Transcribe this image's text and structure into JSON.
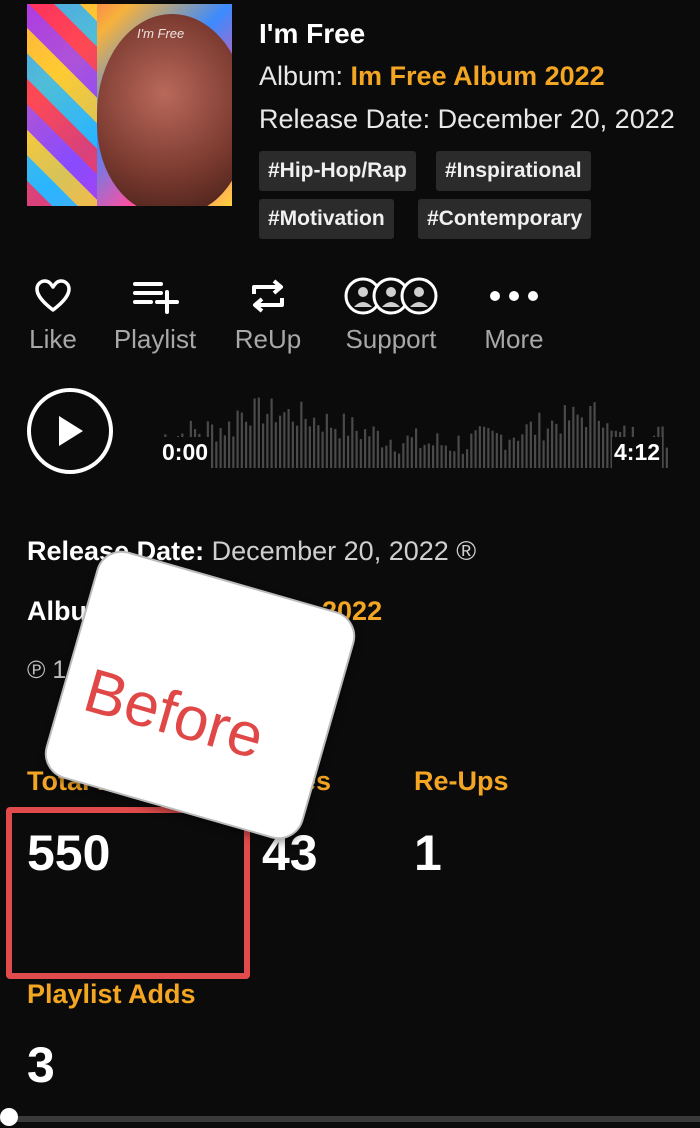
{
  "track": {
    "title": "I'm Free",
    "album_prefix": "Album: ",
    "album_name": "Im Free Album 2022",
    "release_line": "Release Date: December 20, 2022",
    "cover_script": "I'm Free",
    "tags": [
      "#Hip-Hop/Rap",
      "#Inspirational",
      "#Motivation",
      "#Contemporary"
    ]
  },
  "actions": [
    {
      "label": "Like",
      "icon": "heart-icon"
    },
    {
      "label": "Playlist",
      "icon": "playlist-add-icon"
    },
    {
      "label": "ReUp",
      "icon": "repost-icon"
    },
    {
      "label": "Support",
      "icon": "support-avatars-icon"
    },
    {
      "label": "More",
      "icon": "more-dots-icon"
    }
  ],
  "player": {
    "time_start": "0:00",
    "time_end": "4:12"
  },
  "meta": {
    "release_label": "Release Date:",
    "release_value": " December 20, 2022 ®",
    "album_label": "Album:",
    "album_value": "Im Free Album 2022",
    "copyright": "℗ 1 ... DK"
  },
  "stats": {
    "total_plays_label": "Total Plays",
    "total_plays": "550",
    "likes_label": "Likes",
    "likes": "43",
    "reups_label": "Re-Ups",
    "reups": "1",
    "playlist_adds_label": "Playlist Adds",
    "playlist_adds": "3"
  },
  "annotation": {
    "bubble_text": "Before",
    "highlight_color": "#e24b4b"
  },
  "colors": {
    "accent": "#f4a623",
    "background": "#0b0b0b"
  }
}
